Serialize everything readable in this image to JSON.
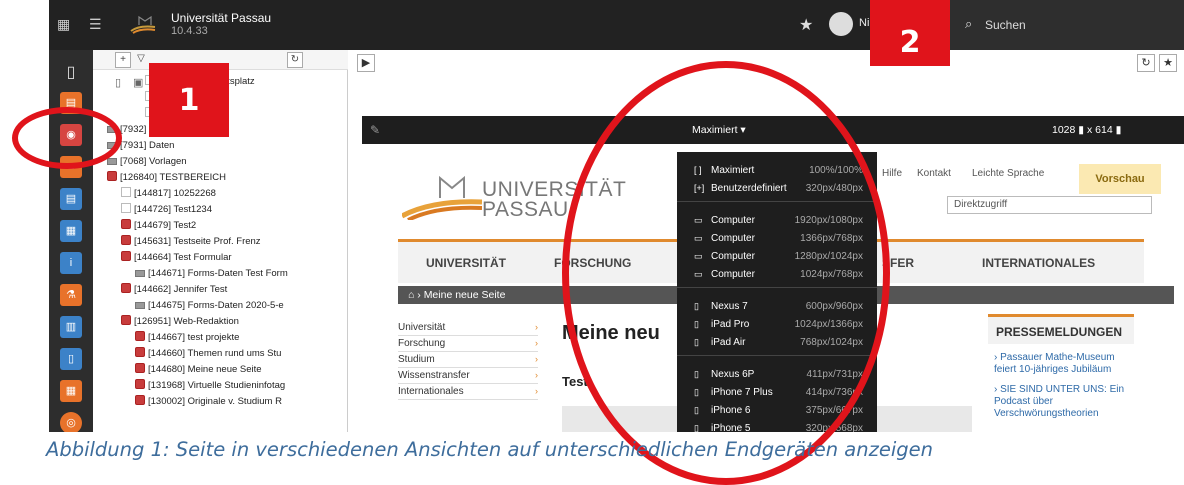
{
  "topbar": {
    "site_name": "Universität Passau",
    "version": "10.4.33",
    "user_name": "Ni",
    "search_placeholder": "Suchen"
  },
  "iconbar": {
    "items": [
      "page-icon",
      "view-icon",
      "list-icon",
      "form-icon",
      "tree-icon",
      "info-icon",
      "lab-icon",
      "news-icon",
      "book-icon",
      "calendar-icon",
      "globe-icon"
    ]
  },
  "tree": {
    "rows": [
      "herheit am Arbeitsplatz",
      "se",
      "es",
      "[7932] Elemente",
      "[7931] Daten",
      "[7068] Vorlagen",
      "[126840] TESTBEREICH",
      "[144817] 10252268",
      "[144726] Test1234",
      "[144679] Test2",
      "[145631] Testseite Prof. Frenz",
      "[144664] Test Formular",
      "[144671] Forms-Daten Test Form",
      "[144662] Jennifer Test",
      "[144675] Forms-Daten 2020-5-e",
      "[126951] Web-Redaktion",
      "[144667] test projekte",
      "[144660] Themen rund ums Stu",
      "[144680] Meine neue Seite",
      "[131968] Virtuelle Studieninfotag",
      "[130002] Originale v. Studium R"
    ]
  },
  "preview": {
    "viewport_label": "Maximiert ▾",
    "width": "1028",
    "height": "614",
    "dims_x": "x"
  },
  "site": {
    "logo_line1": "UNIVERSITÄT",
    "logo_line2": "PASSAU",
    "link_help": "Hilfe",
    "link_contact": "Kontakt",
    "link_easy": "Leichte Sprache",
    "vorschau": "Vorschau",
    "direkt": "Direktzugriff",
    "nav": [
      "UNIVERSITÄT",
      "FORSCHUNG",
      "SFER",
      "INTERNATIONALES"
    ],
    "breadcrumb": "Meine neue Seite",
    "sidenav": [
      "Universität",
      "Forschung",
      "Studium",
      "Wissenstransfer",
      "Internationales"
    ],
    "headline": "Meine neu",
    "test": "Test",
    "press_title": "PRESSEMELDUNGEN",
    "press_items": [
      "Passauer Mathe-Museum feiert 10-jähriges Jubiläum",
      "SIE SIND UNTER UNS: Ein Podcast über Verschwörungstheorien"
    ]
  },
  "dropdown": {
    "groups": [
      [
        {
          "icon": "[ ]",
          "name": "Maximiert",
          "size": "100%/100%"
        },
        {
          "icon": "[+]",
          "name": "Benutzerdefiniert",
          "size": "320px/480px"
        }
      ],
      [
        {
          "icon": "▭",
          "name": "Computer",
          "size": "1920px/1080px"
        },
        {
          "icon": "▭",
          "name": "Computer",
          "size": "1366px/768px"
        },
        {
          "icon": "▭",
          "name": "Computer",
          "size": "1280px/1024px"
        },
        {
          "icon": "▭",
          "name": "Computer",
          "size": "1024px/768px"
        }
      ],
      [
        {
          "icon": "▯",
          "name": "Nexus 7",
          "size": "600px/960px"
        },
        {
          "icon": "▯",
          "name": "iPad Pro",
          "size": "1024px/1366px"
        },
        {
          "icon": "▯",
          "name": "iPad Air",
          "size": "768px/1024px"
        }
      ],
      [
        {
          "icon": "▯",
          "name": "Nexus 6P",
          "size": "411px/731px"
        },
        {
          "icon": "▯",
          "name": "iPhone 7 Plus",
          "size": "414px/736px"
        },
        {
          "icon": "▯",
          "name": "iPhone 6",
          "size": "375px/667px"
        },
        {
          "icon": "▯",
          "name": "iPhone 5",
          "size": "320px/568px"
        }
      ]
    ]
  },
  "annotations": {
    "badge1": "1",
    "badge2": "2"
  },
  "caption": "Abbildung 1: Seite in verschiedenen Ansichten auf unterschiedlichen Endgeräten anzeigen",
  "colors": {
    "accent_red": "#e0141b",
    "brand_orange": "#e08a2e",
    "caption_blue": "#3e6d9c"
  }
}
